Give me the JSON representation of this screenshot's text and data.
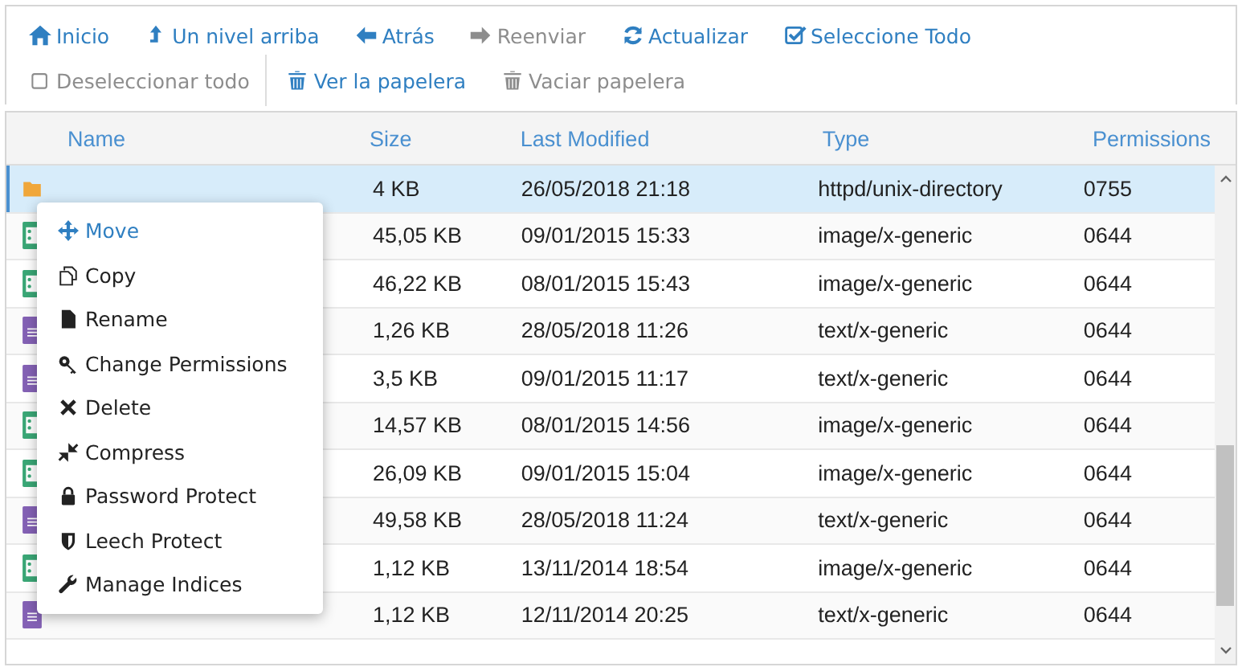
{
  "toolbar": {
    "navigation": [
      {
        "label": "Inicio",
        "kind": "home",
        "disabled": false
      },
      {
        "label": "Un nivel arriba",
        "kind": "up",
        "disabled": false
      },
      {
        "label": "Atrás",
        "kind": "back",
        "disabled": false
      },
      {
        "label": "Reenviar",
        "kind": "forward",
        "disabled": true
      },
      {
        "label": "Actualizar",
        "kind": "refresh",
        "disabled": false
      },
      {
        "label": "Seleccione Todo",
        "kind": "select-all",
        "disabled": false
      }
    ],
    "selection": [
      {
        "label": "Deseleccionar todo",
        "kind": "deselect",
        "disabled": true
      },
      {
        "label": "Ver la papelera",
        "kind": "trash",
        "disabled": false
      },
      {
        "label": "Vaciar papelera",
        "kind": "trash",
        "disabled": true
      }
    ]
  },
  "table": {
    "columns": [
      "Name",
      "Size",
      "Last Modified",
      "Type",
      "Permissions"
    ],
    "rows": [
      {
        "kind": "folder",
        "size": "4 KB",
        "modified": "26/05/2018 21:18",
        "type": "httpd/unix-directory",
        "permissions": "0755",
        "selected": true
      },
      {
        "kind": "image",
        "size": "45,05 KB",
        "modified": "09/01/2015 15:33",
        "type": "image/x-generic",
        "permissions": "0644",
        "selected": false
      },
      {
        "kind": "image",
        "size": "46,22 KB",
        "modified": "08/01/2015 15:43",
        "type": "image/x-generic",
        "permissions": "0644",
        "selected": false
      },
      {
        "kind": "text",
        "size": "1,26 KB",
        "modified": "28/05/2018 11:26",
        "type": "text/x-generic",
        "permissions": "0644",
        "selected": false
      },
      {
        "kind": "text",
        "size": "3,5 KB",
        "modified": "09/01/2015 11:17",
        "type": "text/x-generic",
        "permissions": "0644",
        "selected": false
      },
      {
        "kind": "image",
        "size": "14,57 KB",
        "modified": "08/01/2015 14:56",
        "type": "image/x-generic",
        "permissions": "0644",
        "selected": false
      },
      {
        "kind": "image",
        "size": "26,09 KB",
        "modified": "09/01/2015 15:04",
        "type": "image/x-generic",
        "permissions": "0644",
        "selected": false
      },
      {
        "kind": "text",
        "size": "49,58 KB",
        "modified": "28/05/2018 11:24",
        "type": "text/x-generic",
        "permissions": "0644",
        "selected": false
      },
      {
        "kind": "image",
        "size": "1,12 KB",
        "modified": "13/11/2014 18:54",
        "type": "image/x-generic",
        "permissions": "0644",
        "selected": false
      },
      {
        "kind": "text",
        "size": "1,12 KB",
        "modified": "12/11/2014 20:25",
        "type": "text/x-generic",
        "permissions": "0644",
        "selected": false
      }
    ]
  },
  "context_menu": {
    "items": [
      {
        "label": "Move",
        "kind": "move",
        "selected": true
      },
      {
        "label": "Copy",
        "kind": "copy",
        "selected": false
      },
      {
        "label": "Rename",
        "kind": "rename",
        "selected": false
      },
      {
        "label": "Change Permissions",
        "kind": "key",
        "selected": false
      },
      {
        "label": "Delete",
        "kind": "delete",
        "selected": false
      },
      {
        "label": "Compress",
        "kind": "compress",
        "selected": false
      },
      {
        "label": "Password Protect",
        "kind": "lock",
        "selected": false
      },
      {
        "label": "Leech Protect",
        "kind": "shield",
        "selected": false
      },
      {
        "label": "Manage Indices",
        "kind": "wrench",
        "selected": false
      }
    ]
  }
}
